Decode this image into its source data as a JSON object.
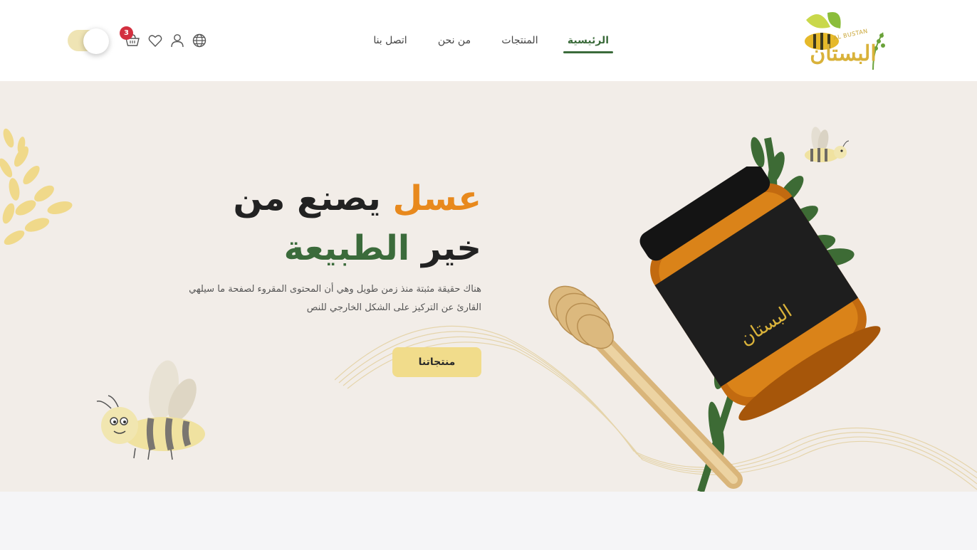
{
  "header": {
    "logo": {
      "text": "البستان",
      "latin": "AL BUSTAN"
    },
    "nav": {
      "home": "الرئيسية",
      "products": "المنتجات",
      "about": "من نحن",
      "contact": "اتصل بنا"
    },
    "icons": [
      "globe-icon",
      "user-icon",
      "heart-icon",
      "cart-icon"
    ],
    "cart_count": "3"
  },
  "hero": {
    "title_line1_accent": "عسل",
    "title_line1_rest": " يصنع من",
    "title_line2_rest": "خير ",
    "title_line2_accent": "الطبيعة",
    "description": "هناك حقيقة مثبتة منذ زمن طويل وهي أن المحتوى المقروء لصفحة ما سيلهي القارئ عن التركيز على الشكل الخارجي للنص",
    "cta_label": "منتجاتنا"
  },
  "colors": {
    "accent_orange": "#e8891d",
    "accent_green": "#3b6b3b",
    "cta_yellow": "#f1dc8b",
    "hero_bg": "#f2ede8",
    "badge_red": "#d32f3f"
  }
}
